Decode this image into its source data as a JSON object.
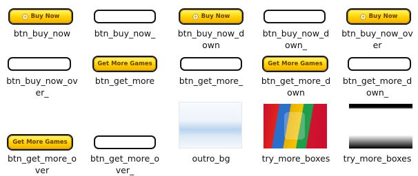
{
  "files": [
    {
      "name": "btn_buy_now",
      "type": "yellow",
      "text": "Buy Now",
      "icon": "plus-circle-icon"
    },
    {
      "name": "btn_buy_now_",
      "type": "white"
    },
    {
      "name": "btn_buy_now_d own",
      "type": "yellow",
      "text": "Buy Now",
      "icon": "plus-circle-icon"
    },
    {
      "name": "btn_buy_now_d own_",
      "type": "white"
    },
    {
      "name": "btn_buy_now_ov er",
      "type": "yellow",
      "text": "Buy Now",
      "icon": "plus-circle-icon"
    },
    {
      "name": "btn_buy_now_ov er_",
      "type": "white"
    },
    {
      "name": "btn_get_more",
      "type": "yellow",
      "text": "Get More Games"
    },
    {
      "name": "btn_get_more_",
      "type": "white"
    },
    {
      "name": "btn_get_more_d own",
      "type": "yellow",
      "text": "Get More Games"
    },
    {
      "name": "btn_get_more_d own_",
      "type": "white"
    },
    {
      "name": "btn_get_more_o ver",
      "type": "yellow",
      "text": "Get More Games"
    },
    {
      "name": "btn_get_more_o ver_",
      "type": "white"
    },
    {
      "name": "outro_bg",
      "type": "image"
    },
    {
      "name": "try_more_boxes",
      "type": "image"
    },
    {
      "name": "try_more_boxes",
      "type": "image"
    }
  ],
  "labels": {
    "f0": [
      "btn_buy_now"
    ],
    "f1": [
      "btn_buy_now_"
    ],
    "f2": [
      "btn_buy_now_d",
      "own"
    ],
    "f3": [
      "btn_buy_now_d",
      "own_"
    ],
    "f4": [
      "btn_buy_now_ov",
      "er"
    ],
    "f5": [
      "btn_buy_now_ov",
      "er_"
    ],
    "f6": [
      "btn_get_more"
    ],
    "f7": [
      "btn_get_more_"
    ],
    "f8": [
      "btn_get_more_d",
      "own"
    ],
    "f9": [
      "btn_get_more_d",
      "own_"
    ],
    "f10": [
      "btn_get_more_o",
      "ver"
    ],
    "f11": [
      "btn_get_more_o",
      "ver_"
    ],
    "f12": [
      "outro_bg"
    ],
    "f13": [
      "try_more_boxes"
    ],
    "f14": [
      "try_more_boxes"
    ]
  },
  "buttons": {
    "buy_now": "Buy Now",
    "get_more": "Get More Games"
  }
}
